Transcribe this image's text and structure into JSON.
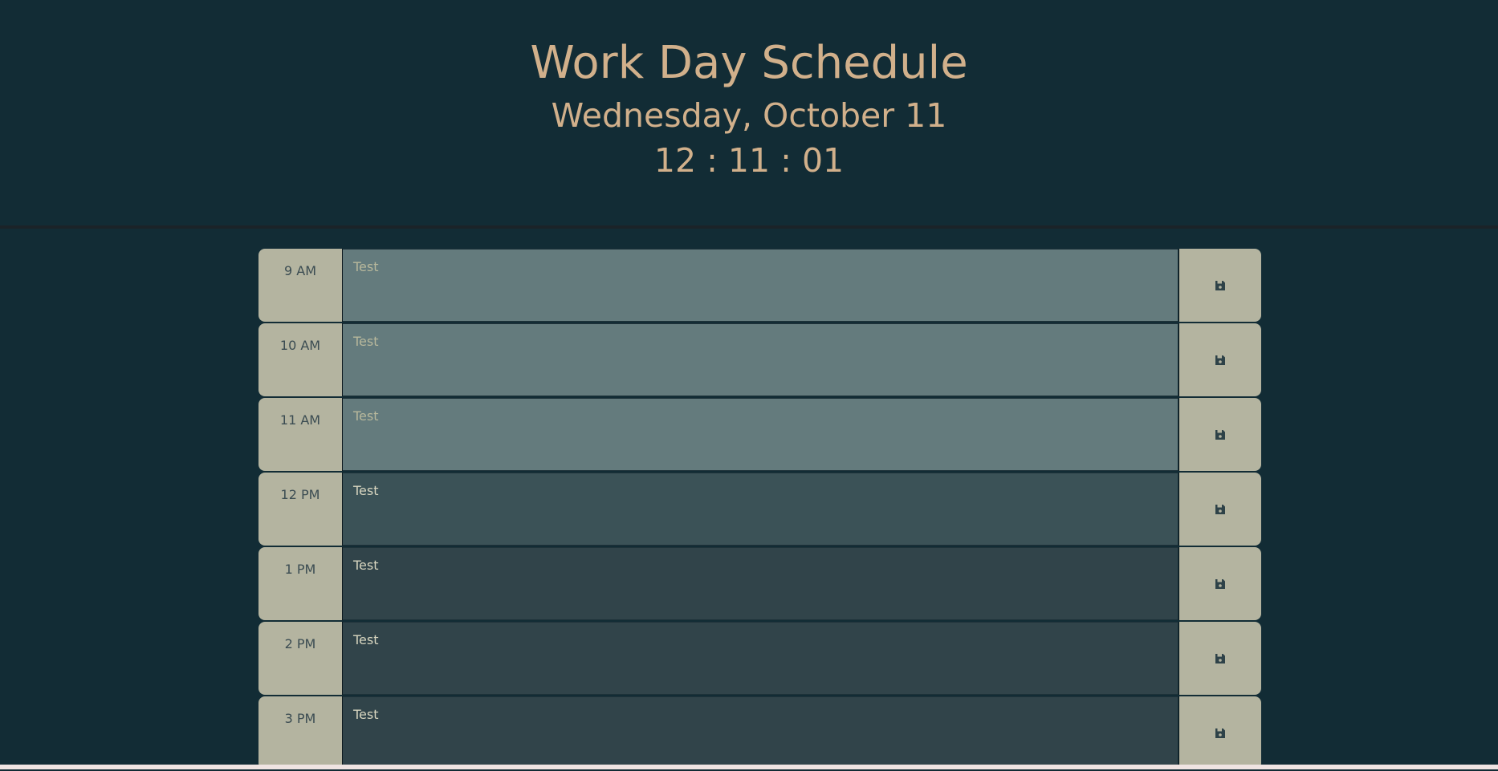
{
  "header": {
    "title": "Work Day Schedule",
    "date": "Wednesday, October 11",
    "time": "12 : 11 : 01"
  },
  "schedule": [
    {
      "hour": "9 AM",
      "text": "Test",
      "state": "past",
      "save_icon": "floppy-disk-icon"
    },
    {
      "hour": "10 AM",
      "text": "Test",
      "state": "past",
      "save_icon": "floppy-disk-icon"
    },
    {
      "hour": "11 AM",
      "text": "Test",
      "state": "past",
      "save_icon": "floppy-disk-icon"
    },
    {
      "hour": "12 PM",
      "text": "Test",
      "state": "present",
      "save_icon": "floppy-disk-icon"
    },
    {
      "hour": "1 PM",
      "text": "Test",
      "state": "future",
      "save_icon": "floppy-disk-icon"
    },
    {
      "hour": "2 PM",
      "text": "Test",
      "state": "future",
      "save_icon": "floppy-disk-icon"
    },
    {
      "hour": "3 PM",
      "text": "Test",
      "state": "future",
      "save_icon": "floppy-disk-icon"
    }
  ],
  "colors": {
    "background": "#122c35",
    "accent_text": "#d1b08b",
    "hour_block": "#b4b4a0",
    "past": "#647b7d",
    "present": "#3b5257",
    "future": "#31444a"
  }
}
